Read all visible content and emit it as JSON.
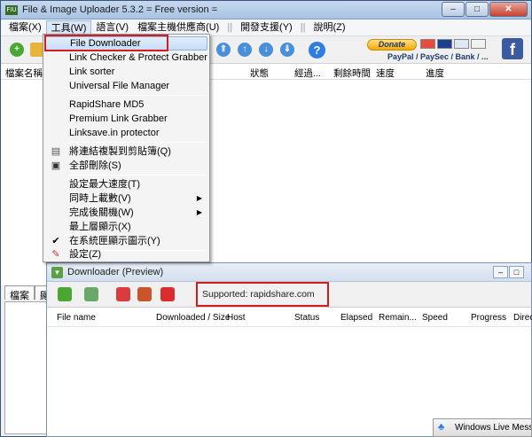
{
  "window": {
    "title": "File & Image Uploader 5.3.2  = Free version =",
    "app_icon_text": "FIU",
    "minimize": "–",
    "maximize": "□",
    "close": "✕"
  },
  "menubar": {
    "items": [
      "檔案(X)",
      "工具(W)",
      "語言(V)",
      "檔案主機供應商(U)",
      "開發支援(Y)",
      "說明(Z)"
    ]
  },
  "toolbar": {
    "help": "?",
    "donate": "Donate",
    "payment_text": "PayPal / PaySec / Bank / ...",
    "facebook": "f"
  },
  "main_table": {
    "columns": [
      "檔案名稱",
      "狀態",
      "經過...",
      "剩餘時間",
      "速度",
      "進度"
    ]
  },
  "bottom_tabs": [
    "檔案",
    "顯"
  ],
  "tools_menu": {
    "items": [
      "File Downloader",
      "Link Checker & Protect Grabber",
      "Link sorter",
      "Universal File Manager",
      "RapidShare MD5",
      "Premium Link Grabber",
      "Linksave.in protector",
      "將連結複製到剪貼簿(Q)",
      "全部刪除(S)",
      "設定最大速度(T)",
      "同時上載數(V)",
      "完成後關機(W)",
      "最上層顯示(X)",
      "在系統匣顯示圖示(Y)",
      "設定(Z)"
    ],
    "submenu_arrow": "▶",
    "checkmark": "✔"
  },
  "downloader": {
    "title": "Downloader (Preview)",
    "supported": "Supported: rapidshare.com",
    "columns": [
      "File name",
      "Downloaded / Size",
      "Host",
      "Status",
      "Elapsed",
      "Remain...",
      "Speed",
      "Progress",
      "Direc..."
    ]
  },
  "taskbar": {
    "wlm_label": "Windows Live Messenger"
  },
  "colors": {
    "highlight_border": "#d41e1e",
    "menu_highlight": "#c6dcf7",
    "donate": "#f7a900",
    "facebook": "#3b5b9e"
  }
}
